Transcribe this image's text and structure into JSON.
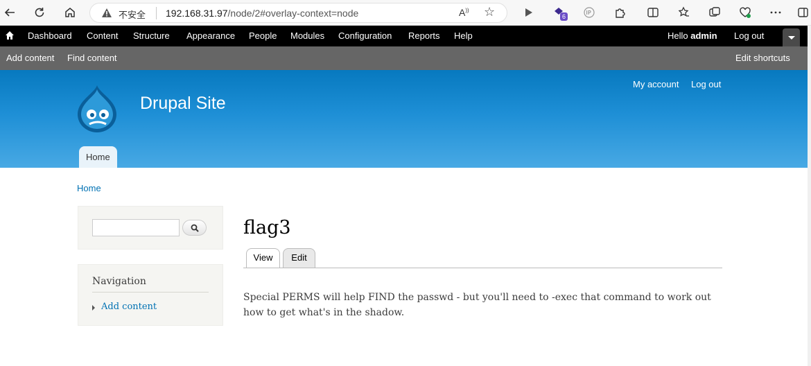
{
  "browser": {
    "security_label": "不安全",
    "url_host": "192.168.31.97",
    "url_path": "/node/2#overlay-context=node",
    "read_aloud_label": "A",
    "extension_badge": "6",
    "icons": [
      "back-icon",
      "refresh-icon",
      "home-icon",
      "warning-icon",
      "read-aloud-icon",
      "favorite-star-icon",
      "play-icon",
      "extension-icon",
      "ip-icon",
      "puzzle-icon",
      "split-screen-icon",
      "favorites-icon",
      "collections-icon",
      "health-icon",
      "more-icon",
      "sidebar-icon"
    ]
  },
  "toolbar": {
    "items": [
      "Dashboard",
      "Content",
      "Structure",
      "Appearance",
      "People",
      "Modules",
      "Configuration",
      "Reports",
      "Help"
    ],
    "hello_prefix": "Hello ",
    "username": "admin",
    "logout": "Log out"
  },
  "shortcuts": {
    "add_content": "Add content",
    "find_content": "Find content",
    "edit_shortcuts": "Edit shortcuts"
  },
  "site": {
    "name": "Drupal Site",
    "secondary_menu": [
      "My account",
      "Log out"
    ],
    "main_menu": [
      "Home"
    ],
    "brand_color": "#0779bf"
  },
  "breadcrumb": "Home",
  "search": {
    "value": ""
  },
  "navigation": {
    "title": "Navigation",
    "items": [
      "Add content"
    ]
  },
  "node": {
    "title": "flag3",
    "tabs": [
      "View",
      "Edit"
    ],
    "active_tab": "View",
    "body": "Special PERMS will help FIND the passwd - but you'll need to -exec that command to work out how to get what's in the shadow."
  }
}
